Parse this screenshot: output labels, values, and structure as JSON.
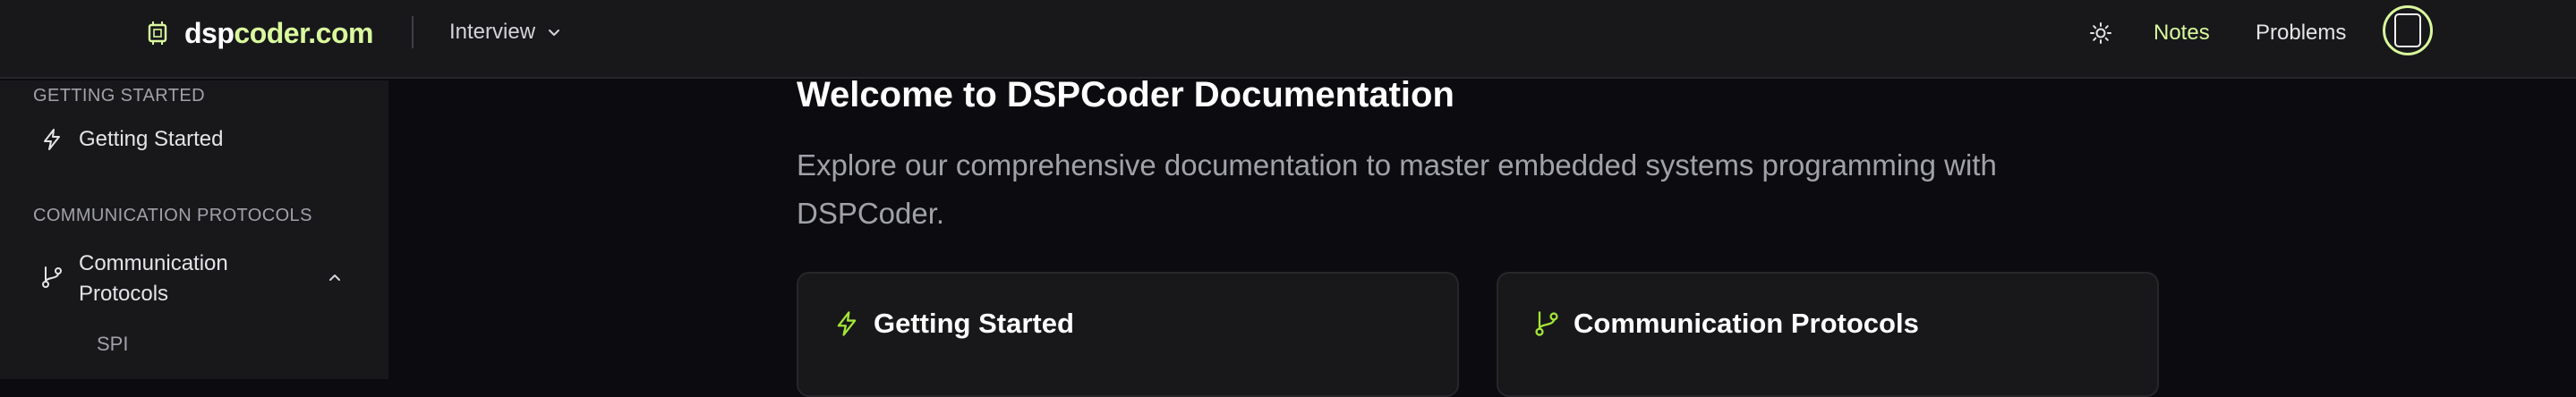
{
  "header": {
    "logo_part1": "dsp",
    "logo_part2": "coder.com",
    "nav_dropdown": "Interview",
    "nav_notes": "Notes",
    "nav_problems": "Problems"
  },
  "sidebar": {
    "sections": [
      {
        "heading": "GETTING STARTED",
        "items": [
          {
            "label": "Getting Started",
            "icon": "lightning-icon"
          }
        ]
      },
      {
        "heading": "COMMUNICATION PROTOCOLS",
        "items": [
          {
            "label": "Communication Protocols",
            "icon": "git-branch-icon",
            "expanded": true,
            "children": [
              "SPI"
            ]
          }
        ]
      }
    ]
  },
  "main": {
    "title": "Welcome to DSPCoder Documentation",
    "description": "Explore our comprehensive documentation to master embedded systems programming with DSPCoder.",
    "cards": [
      {
        "title": "Getting Started",
        "icon": "lightning-icon"
      },
      {
        "title": "Communication Protocols",
        "icon": "git-branch-icon"
      }
    ]
  },
  "colors": {
    "accent": "#d9f99d",
    "accent_icon": "#a3e635",
    "background": "#0c0c10",
    "panel": "#18181b"
  }
}
